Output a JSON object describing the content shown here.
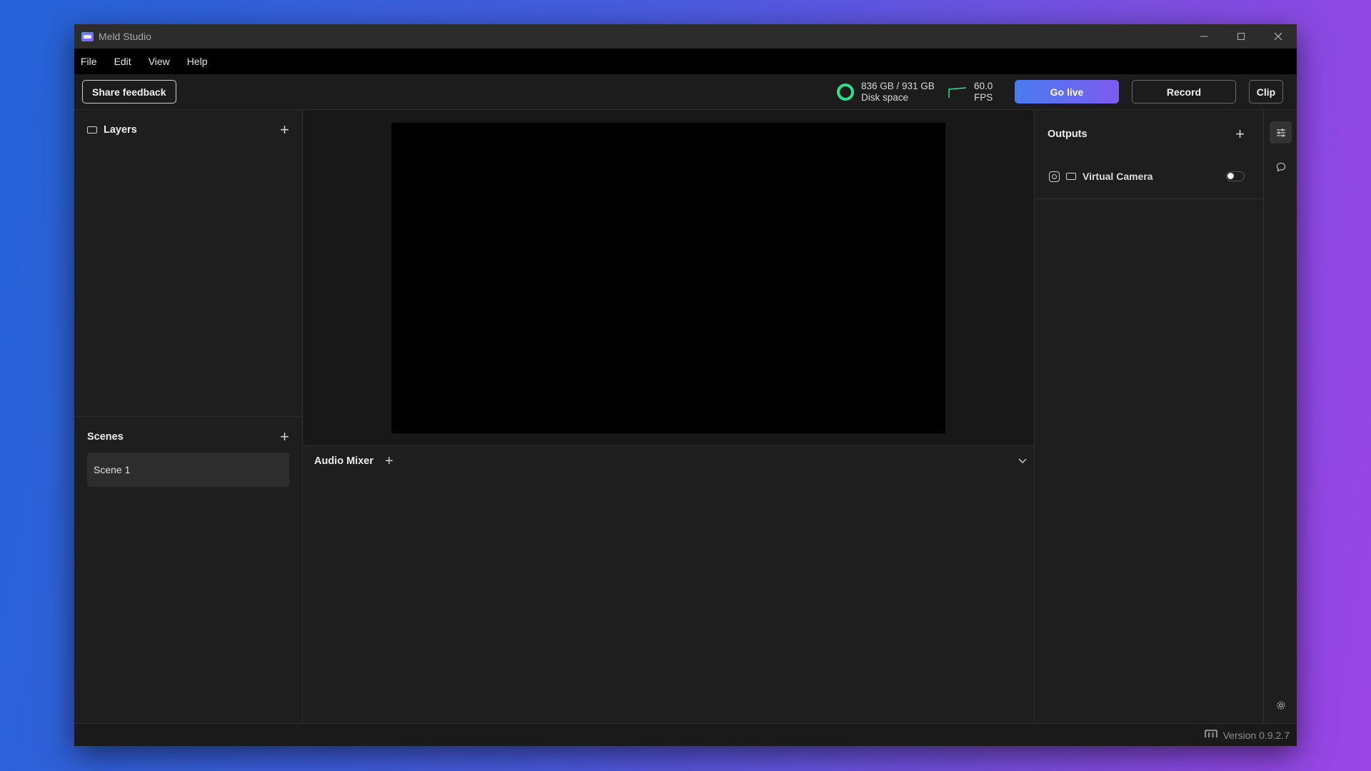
{
  "window": {
    "title": "Meld Studio"
  },
  "menu": [
    "File",
    "Edit",
    "View",
    "Help"
  ],
  "toolbar": {
    "feedback_label": "Share feedback",
    "disk": {
      "value": "836 GB / 931 GB",
      "label": "Disk space"
    },
    "fps": {
      "value": "60.0",
      "label": "FPS"
    },
    "golive_label": "Go live",
    "record_label": "Record",
    "clip_label": "Clip"
  },
  "layers": {
    "title": "Layers"
  },
  "scenes": {
    "title": "Scenes",
    "items": [
      "Scene 1"
    ]
  },
  "mixer": {
    "title": "Audio Mixer"
  },
  "outputs": {
    "title": "Outputs",
    "items": [
      {
        "label": "Virtual Camera",
        "enabled": false
      }
    ]
  },
  "status": {
    "version": "Version 0.9.2.7"
  },
  "colors": {
    "accent_start": "#4a7bf0",
    "accent_end": "#7b5cf0",
    "disk_ring": "#2fe08a"
  }
}
